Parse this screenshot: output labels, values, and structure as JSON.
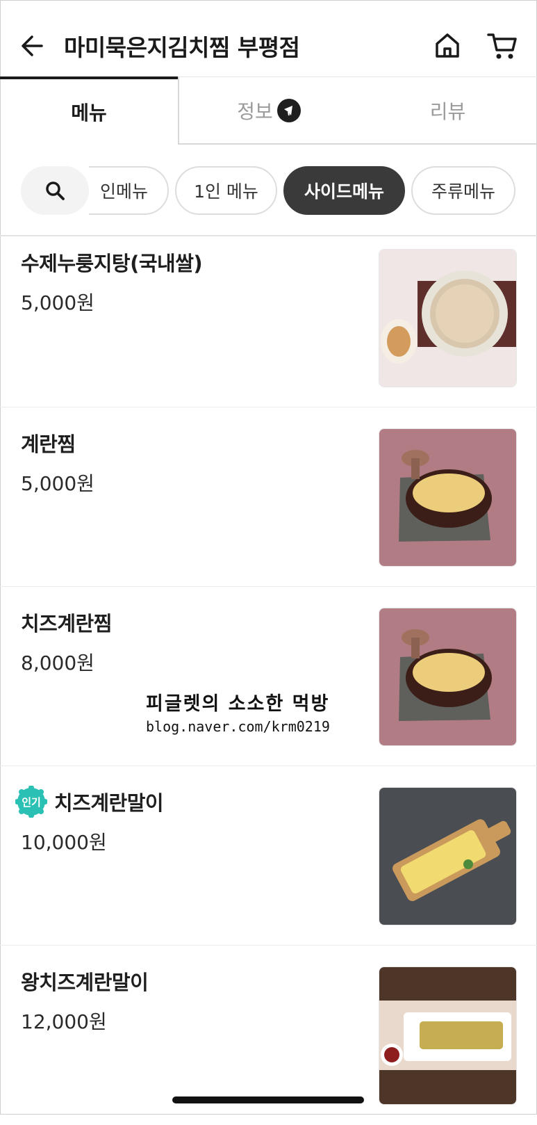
{
  "header": {
    "title": "마미묵은지김치찜 부평점",
    "back_icon": "arrow-left-icon",
    "home_icon": "home-icon",
    "cart_icon": "cart-icon"
  },
  "tabs": [
    {
      "label": "메뉴",
      "active": true
    },
    {
      "label": "정보",
      "active": false,
      "icon": "megaphone-icon"
    },
    {
      "label": "리뷰",
      "active": false
    }
  ],
  "categories": {
    "search_icon": "search-icon",
    "chips": [
      {
        "label": "인메뉴",
        "active": false
      },
      {
        "label": "1인 메뉴",
        "active": false
      },
      {
        "label": "사이드메뉴",
        "active": true
      },
      {
        "label": "주류메뉴",
        "active": false
      }
    ]
  },
  "menu_items": [
    {
      "name": "수제누룽지탕(국내쌀)",
      "price": "5,000원",
      "popular": false,
      "image": "porridge-photo"
    },
    {
      "name": "계란찜",
      "price": "5,000원",
      "popular": false,
      "image": "steamed-egg-photo"
    },
    {
      "name": "치즈계란찜",
      "price": "8,000원",
      "popular": false,
      "image": "cheese-steamed-egg-photo"
    },
    {
      "name": "치즈계란말이",
      "price": "10,000원",
      "popular": true,
      "badge": "인기",
      "image": "cheese-egg-roll-photo"
    },
    {
      "name": "왕치즈계란말이",
      "price": "12,000원",
      "popular": false,
      "image": "king-cheese-egg-roll-photo"
    }
  ],
  "watermark": {
    "line1": "피글렛의 소소한 먹방",
    "line2": "blog.naver.com/krm0219"
  },
  "colors": {
    "active_chip": "#3a3a3a",
    "popular_badge": "#2bc0b4"
  }
}
